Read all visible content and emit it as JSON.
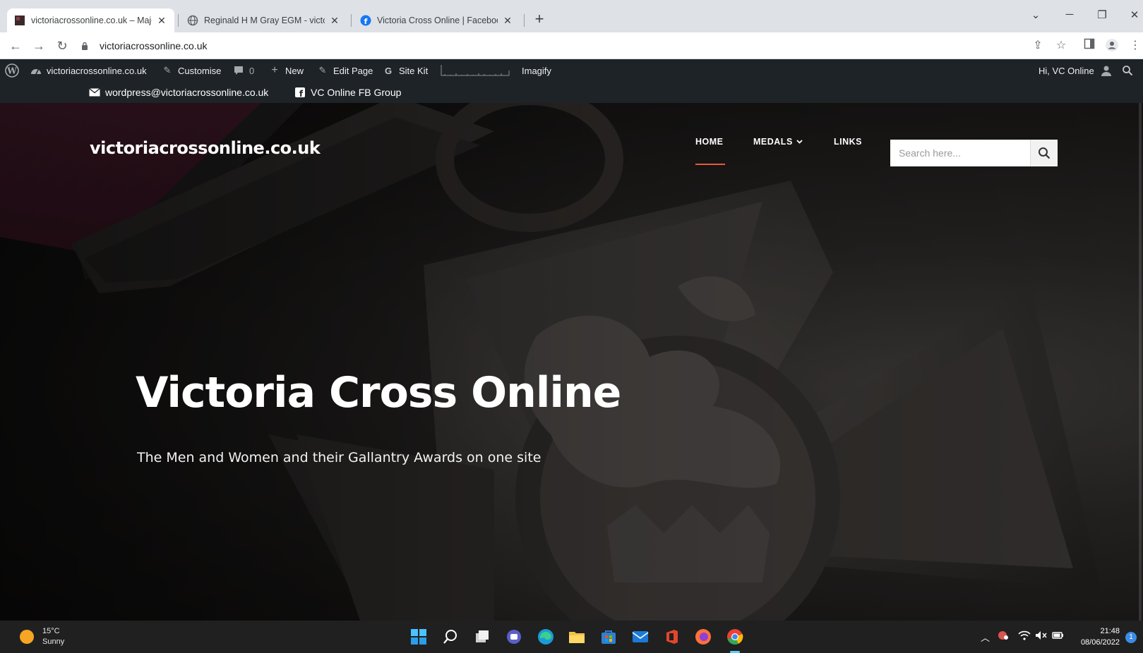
{
  "browser": {
    "tabs": [
      {
        "title": "victoriacrossonline.co.uk – Major",
        "active": true,
        "favicon": "site-favicon"
      },
      {
        "title": "Reginald H M Gray EGM - victor",
        "active": false,
        "favicon": "globe-icon"
      },
      {
        "title": "Victoria Cross Online | Facebook",
        "active": false,
        "favicon": "facebook-icon"
      }
    ],
    "url": "victoriacrossonline.co.uk"
  },
  "admin_bar": {
    "site_name": "victoriacrossonline.co.uk",
    "customise": "Customise",
    "comments_count": "0",
    "new": "New",
    "edit_page": "Edit Page",
    "site_kit": "Site Kit",
    "imagify": "Imagify",
    "greeting": "Hi, VC Online"
  },
  "top_bar": {
    "email": "wordpress@victoriacrossonline.co.uk",
    "fb_group": "VC Online FB Group"
  },
  "site": {
    "title": "victoriacrossonline.co.uk",
    "menu": {
      "home": "HOME",
      "medals": "MEDALS",
      "links": "LINKS"
    },
    "search_placeholder": "Search here...",
    "hero_title": "Victoria Cross Online",
    "hero_subtitle": "The Men and Women and their Gallantry Awards on one site"
  },
  "taskbar": {
    "weather_temp": "15°C",
    "weather_desc": "Sunny",
    "time": "21:48",
    "date": "08/06/2022",
    "notification_count": "1"
  },
  "colors": {
    "admin_bar_bg": "#1d2327",
    "menu_active_underline": "#e25c3e",
    "taskbar_bg": "#202020"
  }
}
